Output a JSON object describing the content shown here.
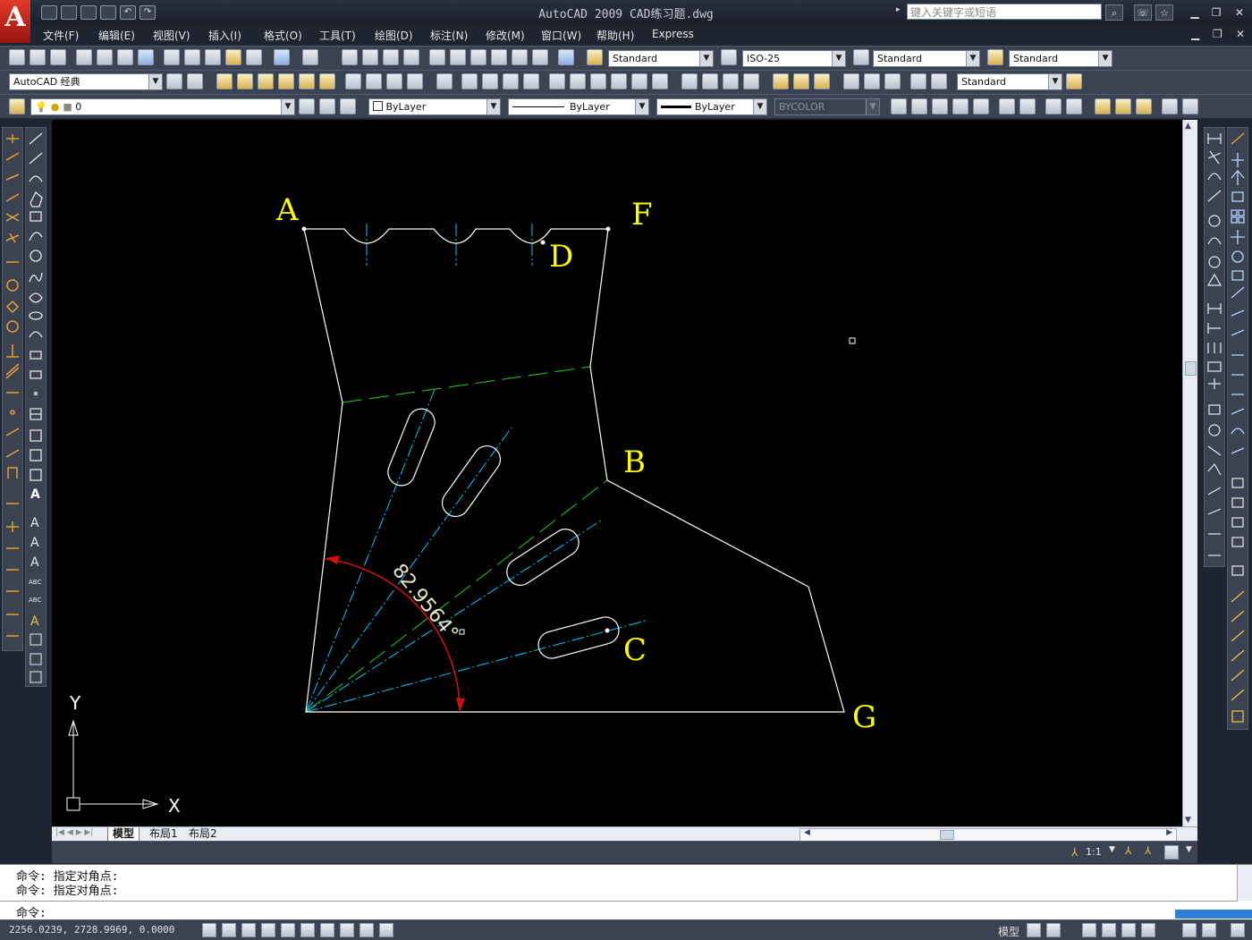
{
  "window": {
    "title": "AutoCAD  2009  CAD练习题.dwg",
    "search_placeholder": "键入关键字或短语",
    "logo": "A"
  },
  "menu": [
    "文件(F)",
    "编辑(E)",
    "视图(V)",
    "插入(I)",
    "格式(O)",
    "工具(T)",
    "绘图(D)",
    "标注(N)",
    "修改(M)",
    "窗口(W)",
    "帮助(H)",
    "Express"
  ],
  "toolbar": {
    "text_style": "Standard",
    "dim_style": "ISO-25",
    "table_style": "Standard",
    "multileader_style": "Standard",
    "workspace": "AutoCAD 经典",
    "layer": "0",
    "color": "ByLayer",
    "linetype": "ByLayer",
    "lineweight": "ByLayer",
    "plotstyle": "BYCOLOR",
    "ml_style2": "Standard"
  },
  "drawing": {
    "labels": {
      "A": "A",
      "F": "F",
      "D": "D",
      "B": "B",
      "C": "C",
      "G": "G"
    },
    "dimension": "82.9564°",
    "ucs": {
      "x": "X",
      "y": "Y"
    },
    "colors": {
      "outline": "#ffffff",
      "label": "#ffff00",
      "center": "#00c8ff",
      "hidden": "#22cc22",
      "dim": "#d01010"
    }
  },
  "tabs": [
    "模型",
    "布局1",
    "布局2"
  ],
  "scale": "1:1",
  "command": {
    "history": [
      "命令: 指定对角点:",
      "命令: 指定对角点:"
    ],
    "prompt": "命令:"
  },
  "status": {
    "coords": "2256.0239,  2728.9969,  0.0000",
    "model": "模型"
  }
}
